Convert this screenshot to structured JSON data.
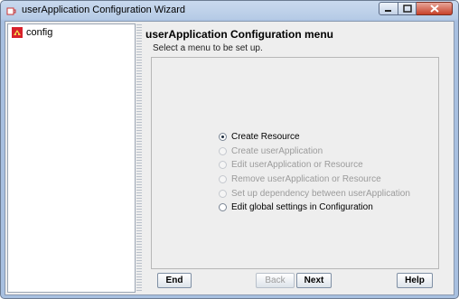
{
  "window": {
    "title": "userApplication Configuration Wizard"
  },
  "tree": {
    "items": [
      {
        "label": "config",
        "icon": "config-node-icon"
      }
    ]
  },
  "main": {
    "heading": "userApplication Configuration menu",
    "instruction": "Select a menu to be set up.",
    "options": [
      {
        "label": "Create Resource",
        "selected": true,
        "enabled": true
      },
      {
        "label": "Create userApplication",
        "selected": false,
        "enabled": false
      },
      {
        "label": "Edit userApplication or Resource",
        "selected": false,
        "enabled": false
      },
      {
        "label": "Remove userApplication or Resource",
        "selected": false,
        "enabled": false
      },
      {
        "label": "Set up dependency between userApplication",
        "selected": false,
        "enabled": false
      },
      {
        "label": "Edit global settings in Configuration",
        "selected": false,
        "enabled": true
      }
    ]
  },
  "buttons": {
    "end": "End",
    "back": "Back",
    "next": "Next",
    "help": "Help"
  },
  "colors": {
    "titlebar": "#b6cbe6",
    "close": "#c7412a",
    "disabled_text": "#9b9b9b"
  }
}
